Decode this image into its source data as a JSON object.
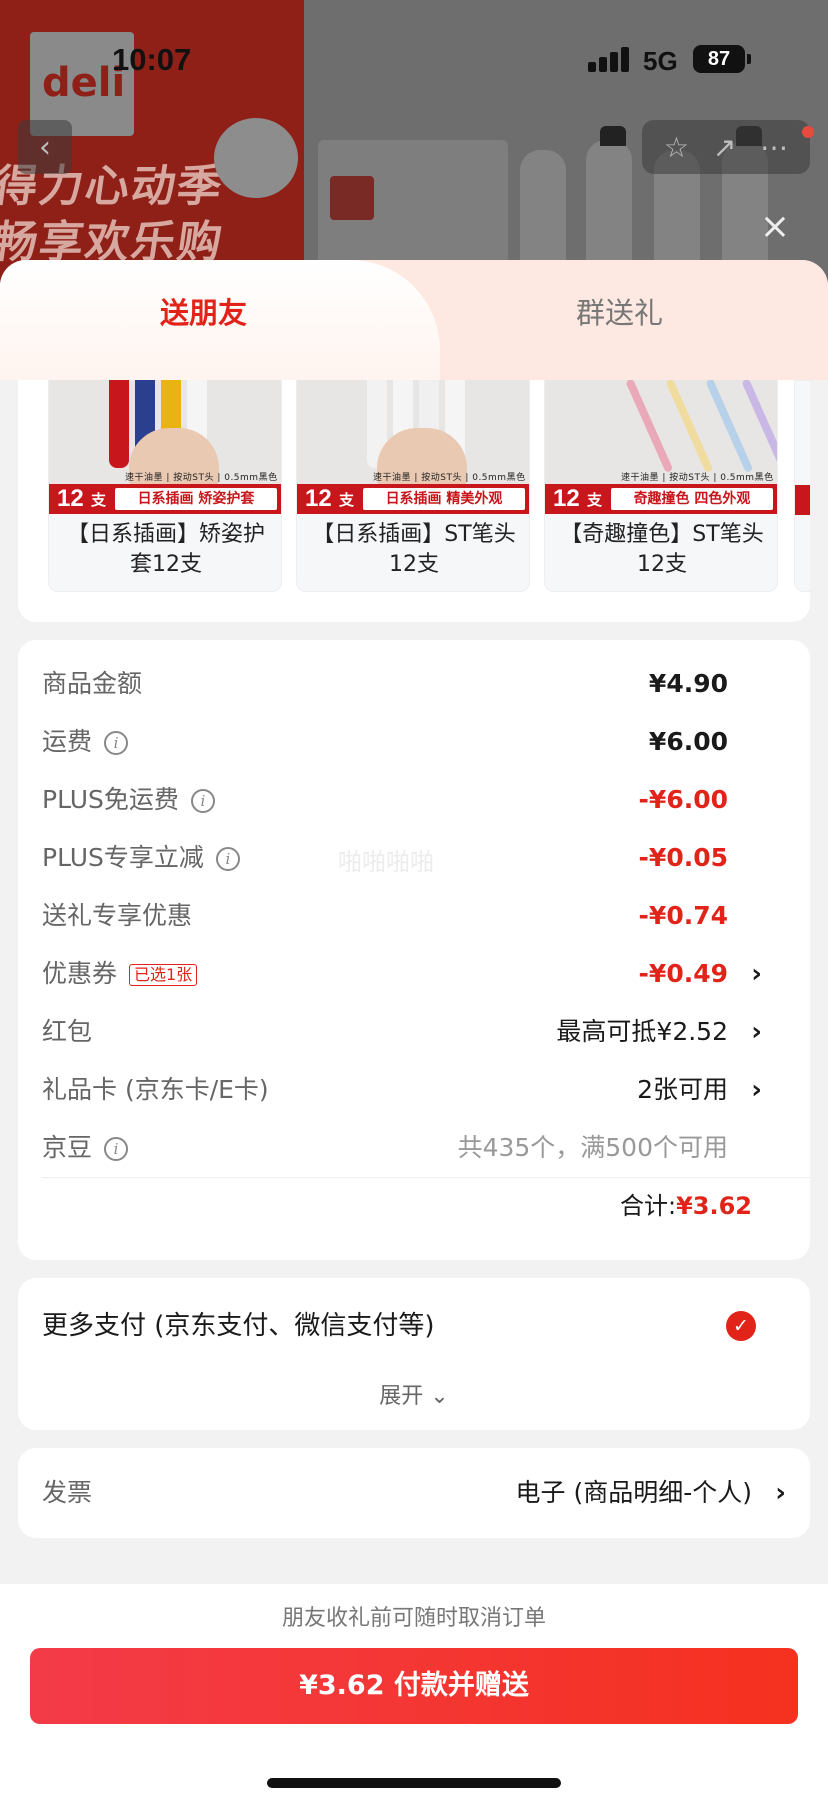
{
  "status_bar": {
    "time": "10:07",
    "network": "5G",
    "battery": "87"
  },
  "background": {
    "brand_logo": "deli",
    "promo_line1": "得力心动季",
    "promo_line2": "畅享欢乐购"
  },
  "tabs": [
    {
      "label": "送朋友",
      "active": true
    },
    {
      "label": "群送礼",
      "active": false
    }
  ],
  "products": [
    {
      "count": "12",
      "unit": "支",
      "spec": "速干油墨 | 按动ST头 | 0.5mm黑色",
      "feature": "日系插画 矫姿护套",
      "name": "【日系插画】矫姿护套12支"
    },
    {
      "count": "12",
      "unit": "支",
      "spec": "速干油墨 | 按动ST头 | 0.5mm黑色",
      "feature": "日系插画 精美外观",
      "name": "【日系插画】ST笔头12支"
    },
    {
      "count": "12",
      "unit": "支",
      "spec": "速干油墨 | 按动ST头 | 0.5mm黑色",
      "feature": "奇趣撞色 四色外观",
      "name": "【奇趣撞色】ST笔头12支"
    }
  ],
  "price_rows": {
    "goods_amount": {
      "label": "商品金额",
      "value": "¥4.90"
    },
    "shipping": {
      "label": "运费",
      "value": "¥6.00"
    },
    "plus_free_shipping": {
      "label": "PLUS免运费",
      "value": "-¥6.00"
    },
    "plus_discount": {
      "label": "PLUS专享立减",
      "value": "-¥0.05"
    },
    "gift_discount": {
      "label": "送礼专享优惠",
      "value": "-¥0.74"
    },
    "coupon": {
      "label": "优惠券",
      "chip": "已选1张",
      "value": "-¥0.49"
    },
    "red_packet": {
      "label": "红包",
      "value": "最高可抵¥2.52"
    },
    "gift_card": {
      "label": "礼品卡 (京东卡/E卡)",
      "value": "2张可用"
    },
    "jd_beans": {
      "label": "京豆",
      "value": "共435个，满500个可用"
    }
  },
  "total": {
    "label": "合计:",
    "amount": "¥3.62"
  },
  "watermark": "啪啪啪啪",
  "payment": {
    "title": "更多支付 (京东支付、微信支付等)",
    "expand_label": "展开"
  },
  "invoice": {
    "label": "发票",
    "value": "电子 (商品明细-个人)"
  },
  "footer": {
    "note": "朋友收礼前可随时取消订单",
    "pay_button": "¥3.62 付款并赠送"
  },
  "colors": {
    "accent": "#e2231a",
    "tab_bg": "#fde9e1",
    "sheet_bg": "#f2f2f2"
  },
  "icons": [
    "back-icon",
    "star-icon",
    "share-icon",
    "more-icon",
    "close-icon",
    "info-icon",
    "chevron-right-icon",
    "chevron-down-icon",
    "check-icon"
  ]
}
